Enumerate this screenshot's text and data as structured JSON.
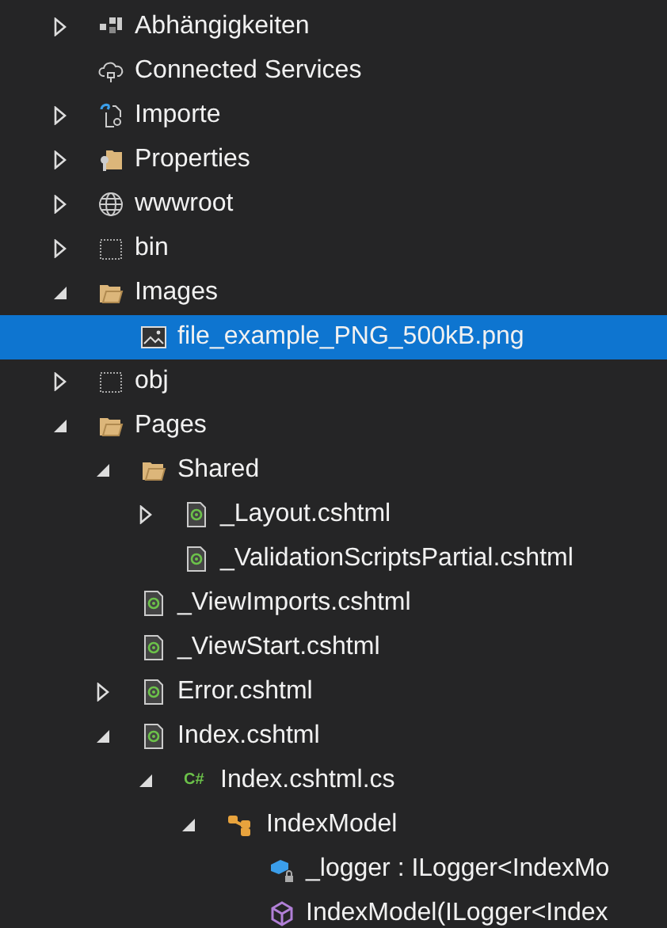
{
  "tree": [
    {
      "label": "Abhängigkeiten",
      "kind": "dependencies",
      "expanded": false,
      "selected": false
    },
    {
      "label": "Connected Services",
      "kind": "cloud",
      "selected": false
    },
    {
      "label": "Importe",
      "kind": "import",
      "expanded": false,
      "selected": false
    },
    {
      "label": "Properties",
      "kind": "properties",
      "expanded": false,
      "selected": false
    },
    {
      "label": "wwwroot",
      "kind": "globe",
      "expanded": false,
      "selected": false
    },
    {
      "label": "bin",
      "kind": "excluded",
      "expanded": false,
      "selected": false
    },
    {
      "label": "Images",
      "kind": "folder",
      "expanded": true,
      "selected": false,
      "children": [
        {
          "label": "file_example_PNG_500kB.png",
          "kind": "image",
          "selected": true
        }
      ]
    },
    {
      "label": "obj",
      "kind": "excluded",
      "expanded": false,
      "selected": false
    },
    {
      "label": "Pages",
      "kind": "folder",
      "expanded": true,
      "selected": false,
      "children": [
        {
          "label": "Shared",
          "kind": "folder",
          "expanded": true,
          "selected": false,
          "children": [
            {
              "label": "_Layout.cshtml",
              "kind": "razor",
              "expanded": false,
              "selected": false
            },
            {
              "label": "_ValidationScriptsPartial.cshtml",
              "kind": "razor",
              "selected": false
            }
          ]
        },
        {
          "label": "_ViewImports.cshtml",
          "kind": "razor",
          "selected": false
        },
        {
          "label": "_ViewStart.cshtml",
          "kind": "razor",
          "selected": false
        },
        {
          "label": "Error.cshtml",
          "kind": "razor",
          "expanded": false,
          "selected": false
        },
        {
          "label": "Index.cshtml",
          "kind": "razor",
          "expanded": true,
          "selected": false,
          "children": [
            {
              "label": "Index.cshtml.cs",
              "kind": "csharp",
              "badge": "C#",
              "expanded": true,
              "selected": false,
              "children": [
                {
                  "label": "IndexModel",
                  "kind": "class",
                  "expanded": true,
                  "selected": false,
                  "children": [
                    {
                      "label": "_logger : ILogger<IndexMo",
                      "kind": "field",
                      "selected": false
                    },
                    {
                      "label": "IndexModel(ILogger<Index",
                      "kind": "method",
                      "selected": false
                    }
                  ]
                }
              ]
            }
          ]
        }
      ]
    }
  ]
}
